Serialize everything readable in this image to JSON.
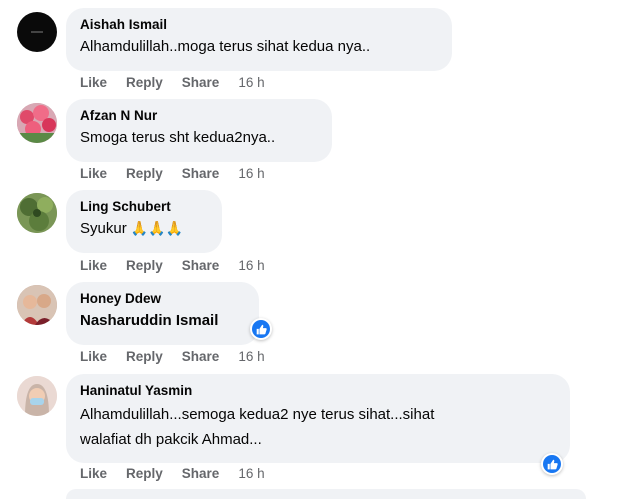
{
  "actions": {
    "like": "Like",
    "reply": "Reply",
    "share": "Share"
  },
  "comments": [
    {
      "author": "Aishah Ismail",
      "text": "Alhamdulillah..moga terus sihat kedua nya..",
      "time": "16 h"
    },
    {
      "author": "Afzan N Nur",
      "text": "Smoga terus sht kedua2nya..",
      "time": "16 h"
    },
    {
      "author": "Ling Schubert",
      "text": "Syukur",
      "emoji": "🙏🙏🙏",
      "time": "16 h"
    },
    {
      "author": "Honey Ddew",
      "mention": "Nasharuddin Ismail",
      "time": "16 h"
    },
    {
      "author": "Haninatul Yasmin",
      "text_line1": "Alhamdulillah...semoga kedua2 nye terus sihat...sihat",
      "text_line2": "walafiat dh pakcik Ahmad...",
      "time": "16 h"
    }
  ],
  "colors": {
    "bubble": "#f0f2f5",
    "like_blue": "#1877f2",
    "meta": "#65676b"
  }
}
